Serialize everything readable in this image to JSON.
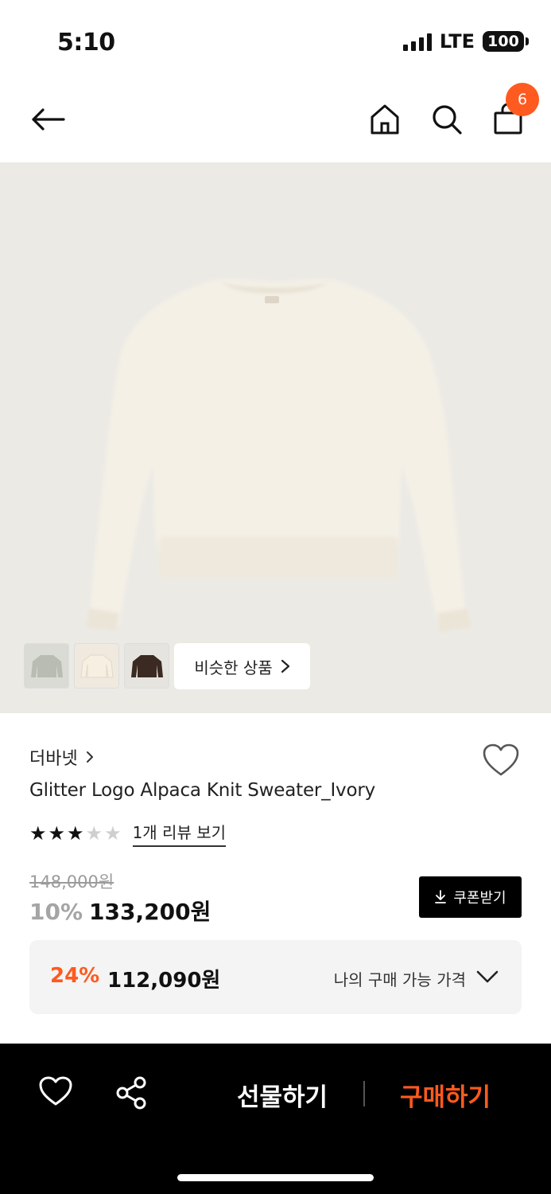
{
  "status": {
    "time": "5:10",
    "network": "LTE",
    "battery": "100"
  },
  "nav": {
    "back_icon": "arrow-left-icon",
    "home_icon": "home-icon",
    "search_icon": "search-icon",
    "cart_icon": "shopping-bag-icon",
    "cart_count": "6"
  },
  "gallery": {
    "thumbnails": [
      "gray",
      "ivory",
      "brown"
    ],
    "similar_label": "비슷한 상품"
  },
  "product": {
    "brand": "더바넷",
    "name": "Glitter Logo Alpaca Knit Sweater_Ivory",
    "rating": 3,
    "rating_max": 5,
    "review_link": "1개 리뷰 보기",
    "original_price": "148,000원",
    "discount_rate": "10%",
    "sale_price": "133,200원",
    "coupon_label": "쿠폰받기"
  },
  "my_price": {
    "discount_rate": "24%",
    "amount": "112,090원",
    "label": "나의 구매 가능 가격"
  },
  "bottom_bar": {
    "gift_label": "선물하기",
    "buy_label": "구매하기"
  },
  "colors": {
    "accent": "#ff5a1f",
    "bottom_bar": "#000000",
    "hero_bg": "#ebeae5"
  }
}
